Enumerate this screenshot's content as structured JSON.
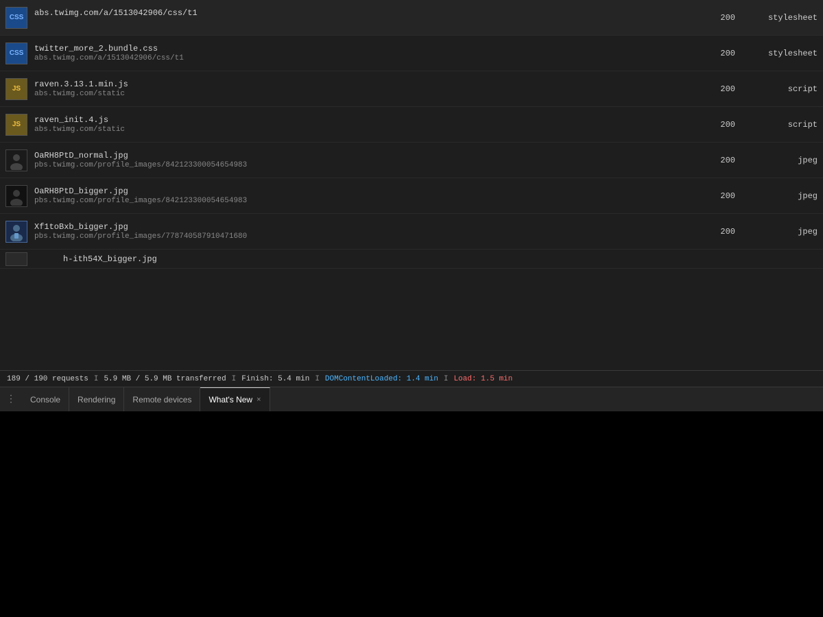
{
  "devtools": {
    "rows": [
      {
        "id": "row1",
        "icon_type": "css",
        "filename": "",
        "url": "abs.twimg.com/a/1513042906/css/t1",
        "status": "200",
        "type": "stylesheet"
      },
      {
        "id": "row2",
        "icon_type": "css",
        "filename": "twitter_more_2.bundle.css",
        "url": "abs.twimg.com/a/1513042906/css/t1",
        "status": "200",
        "type": "stylesheet"
      },
      {
        "id": "row3",
        "icon_type": "js",
        "filename": "raven.3.13.1.min.js",
        "url": "abs.twimg.com/static",
        "status": "200",
        "type": "script"
      },
      {
        "id": "row4",
        "icon_type": "js",
        "filename": "raven_init.4.js",
        "url": "abs.twimg.com/static",
        "status": "200",
        "type": "script"
      },
      {
        "id": "row5",
        "icon_type": "img_dark",
        "filename": "OaRH8PtD_normal.jpg",
        "url": "pbs.twimg.com/profile_images/842123300054654983",
        "status": "200",
        "type": "jpeg"
      },
      {
        "id": "row6",
        "icon_type": "img_dark",
        "filename": "OaRH8PtD_bigger.jpg",
        "url": "pbs.twimg.com/profile_images/842123300054654983",
        "status": "200",
        "type": "jpeg"
      },
      {
        "id": "row7",
        "icon_type": "img_blue",
        "filename": "Xf1toBxb_bigger.jpg",
        "url": "pbs.twimg.com/profile_images/778740587910471680",
        "status": "200",
        "type": "jpeg"
      }
    ],
    "partial_row": {
      "filename": "h-ith54X_bigger.jpg"
    },
    "status_bar": {
      "requests": "189 / 190 requests",
      "separator1": "I",
      "transfer": "5.9 MB / 5.9 MB transferred",
      "separator2": "I",
      "finish": "Finish: 5.4 min",
      "separator3": "I",
      "domcontent_label": "DOMContentLoaded: 1.4 min",
      "separator4": "I",
      "load_label": "Load: 1.5 min"
    },
    "tabs": {
      "menu_icon": "⋮",
      "items": [
        {
          "id": "console",
          "label": "Console",
          "active": false,
          "closeable": false
        },
        {
          "id": "rendering",
          "label": "Rendering",
          "active": false,
          "closeable": false
        },
        {
          "id": "remote-devices",
          "label": "Remote devices",
          "active": false,
          "closeable": false
        },
        {
          "id": "whats-new",
          "label": "What's New",
          "active": true,
          "closeable": true,
          "close_label": "×"
        }
      ]
    }
  }
}
